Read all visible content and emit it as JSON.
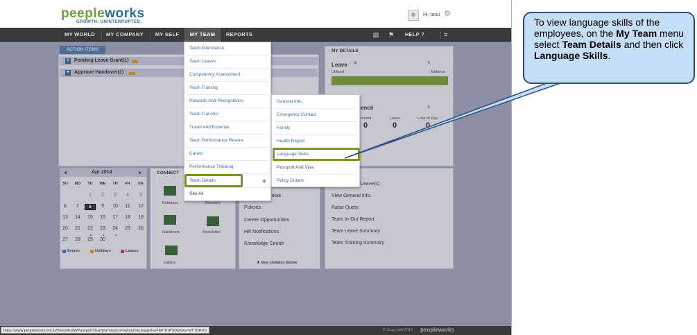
{
  "header": {
    "logo_part1": "peeple",
    "logo_part2": "works",
    "tagline": "GROWTH. UNINTERRUPTED.",
    "greeting": "Hi, tanu"
  },
  "nav": {
    "items": [
      "MY WORLD",
      "MY COMPANY",
      "MY SELF",
      "MY TEAM",
      "REPORTS"
    ],
    "help": "HELP"
  },
  "action_items": {
    "tab": "ACTION ITEMS",
    "rows": [
      "Pending Leave Grant(1)",
      "Approve Handover(1)"
    ]
  },
  "my_details": {
    "title": "MY DETAILS",
    "leave_title": "Leave",
    "availed": "Utilised",
    "balance": "Balance",
    "attendance_title": "ence",
    "att_cols": [
      "resent",
      "Leave",
      "Loss of Pay"
    ],
    "att_values": [
      "0",
      "0",
      "0"
    ]
  },
  "calendar": {
    "month": "Apr 2014",
    "days": [
      "SU",
      "MO",
      "TU",
      "WE",
      "TH",
      "FR",
      "SA"
    ],
    "weeks": [
      [
        "",
        "",
        "1",
        "2",
        "3",
        "4",
        "5"
      ],
      [
        "6",
        "7",
        "8",
        "9",
        "10",
        "11",
        "12"
      ],
      [
        "13",
        "14",
        "15",
        "16",
        "17",
        "18",
        "19"
      ],
      [
        "20",
        "21",
        "22",
        "23",
        "24",
        "25",
        "26"
      ],
      [
        "27",
        "28",
        "29",
        "30",
        "",
        "",
        ""
      ]
    ],
    "legend": [
      "Events",
      "Holidays",
      "Leaves"
    ]
  },
  "connect": {
    "title": "CONNECT",
    "items": [
      "Birthdays",
      "Directory",
      "Handbook",
      "Newsletter",
      "Gallery"
    ]
  },
  "middle_panel": {
    "items": [
      "etail",
      "Policies",
      "Career Opportunities",
      "HR Notifications",
      "Knowledge Center"
    ],
    "footer": "New Updates Below"
  },
  "quick_links": {
    "title": "S",
    "items": [
      "Leave(s)",
      "View General Info.",
      "Raise Query",
      "Team In-Out Report",
      "Team Leave Summary",
      "Team Training Summary"
    ]
  },
  "team_menu": {
    "items": [
      "Team Attendance",
      "Team Leaves",
      "Competency Assessment",
      "Team Training",
      "Rewards And Recognitions",
      "Team Transfer",
      "Travel And Expense",
      "Team Performance Review",
      "Career",
      "Performance Tracking",
      "Team Details",
      "See All"
    ]
  },
  "team_details_submenu": {
    "items": [
      "General Info.",
      "Emergency Contact",
      "Family",
      "Health Report",
      "Language Skills",
      "Passport And Visa",
      "Policy Details"
    ]
  },
  "status": {
    "url": "https://www.peopleworks.ind.in/Demo/EDM/PassportVisa?permission=myteam&UsageKey=MTTDPVD&Key=MTTDPVD",
    "copyright": "© Copyright 2014",
    "footer_logo": "peopleworks"
  },
  "callout": {
    "p1": "To view language skills of the employees, on the ",
    "b1": "My Team",
    "p2": " menu select ",
    "b2": "Team Details",
    "p3": " and then click ",
    "b3": "Language Skills",
    "p4": "."
  },
  "colors": {
    "accent": "#79952a",
    "callout_bg": "#c5ddf5",
    "callout_border": "#2a4c80",
    "nav_bg": "#3a3a3a",
    "overlay": "#8c8fa3"
  }
}
